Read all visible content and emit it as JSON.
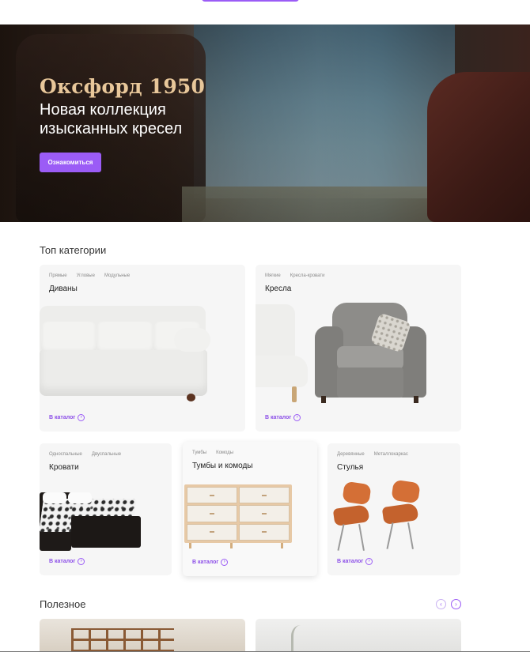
{
  "hero": {
    "title": "Оксфорд 1950",
    "subtitle": "Новая коллекция изысканных кресел",
    "button_label": "Ознакомиться"
  },
  "categories_section": {
    "title": "Топ категории",
    "cards": [
      {
        "title": "Диваны",
        "tags": [
          "Прямые",
          "Угловые",
          "Модульные"
        ],
        "link": "В каталог"
      },
      {
        "title": "Кресла",
        "tags": [
          "Мягкие",
          "Кресла-кровати"
        ],
        "link": "В каталог"
      },
      {
        "title": "Кровати",
        "tags": [
          "Односпальные",
          "Двуспальные"
        ],
        "link": "В каталог"
      },
      {
        "title": "Тумбы и комоды",
        "tags": [
          "Тумбы",
          "Комоды"
        ],
        "link": "В каталог"
      },
      {
        "title": "Стулья",
        "tags": [
          "Деревянные",
          "Металлокаркас"
        ],
        "link": "В каталог"
      }
    ]
  },
  "useful_section": {
    "title": "Полезное",
    "prev_icon": "chevron-left-icon",
    "next_icon": "chevron-right-icon"
  },
  "colors": {
    "accent": "#9b5cf6",
    "hero_title": "#e8c79a",
    "card_bg": "#f6f6f6"
  }
}
